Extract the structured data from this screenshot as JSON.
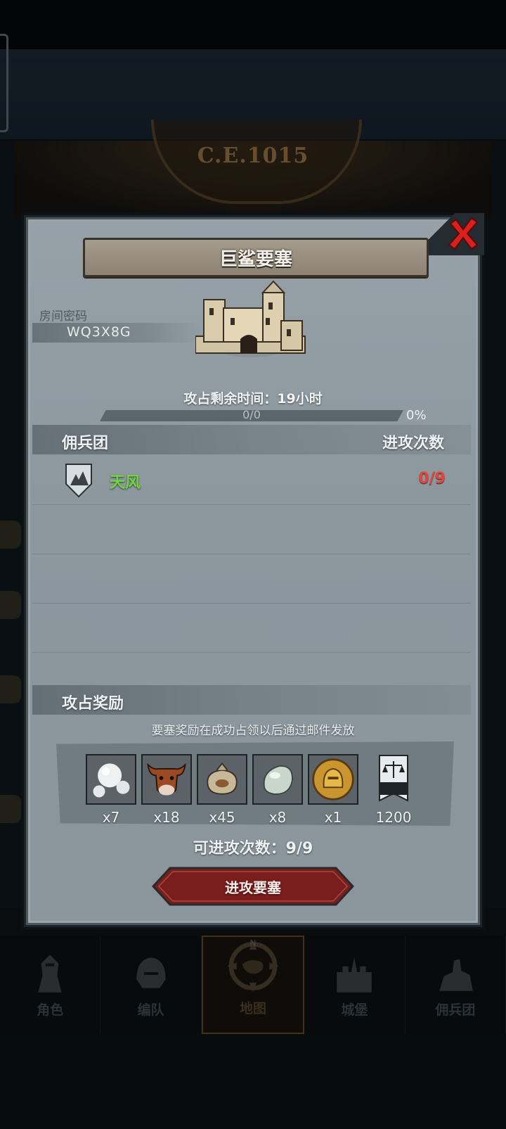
{
  "background": {
    "era_label": "C.E.1015"
  },
  "modal": {
    "title": "巨鲨要塞",
    "room_code_label": "房间密码",
    "room_code": "WQ3X8G",
    "remaining_time_label": "攻占剩余时间：",
    "remaining_time_value": "19小时",
    "progress": {
      "text": "0/0",
      "percent_label": "0%",
      "fraction": 0
    },
    "mercenary_section": {
      "header_left": "佣兵团",
      "header_right": "进攻次数",
      "rows": [
        {
          "name": "天风",
          "attacks": "0/9",
          "shield_icon": "mountain-shield-icon"
        }
      ]
    },
    "rewards_section": {
      "title": "攻占奖励",
      "note": "要塞奖励在成功占领以后通过邮件发放",
      "items": [
        {
          "icon": "pearl-icon",
          "qty": "x7"
        },
        {
          "icon": "bull-icon",
          "qty": "x18"
        },
        {
          "icon": "sack-icon",
          "qty": "x45"
        },
        {
          "icon": "jade-stone-icon",
          "qty": "x8"
        },
        {
          "icon": "gold-helmet-coin-icon",
          "qty": "x1"
        },
        {
          "icon": "justice-banner-icon",
          "qty": "1200"
        }
      ]
    },
    "attacks_available_label": "可进攻次数：",
    "attacks_available_value": "9/9",
    "attack_button_label": "进攻要塞"
  },
  "bottom_nav": {
    "items": [
      {
        "label": "角色",
        "icon": "knight-icon"
      },
      {
        "label": "编队",
        "icon": "helmet-icon"
      },
      {
        "label": "地图",
        "icon": "compass-map-icon",
        "active": true
      },
      {
        "label": "城堡",
        "icon": "castle-icon"
      },
      {
        "label": "佣兵团",
        "icon": "cavalry-icon"
      }
    ],
    "compass_n": "N"
  },
  "colors": {
    "accent_green": "#74d246",
    "accent_red": "#e0453e",
    "button_red": "#7a1d1d"
  }
}
